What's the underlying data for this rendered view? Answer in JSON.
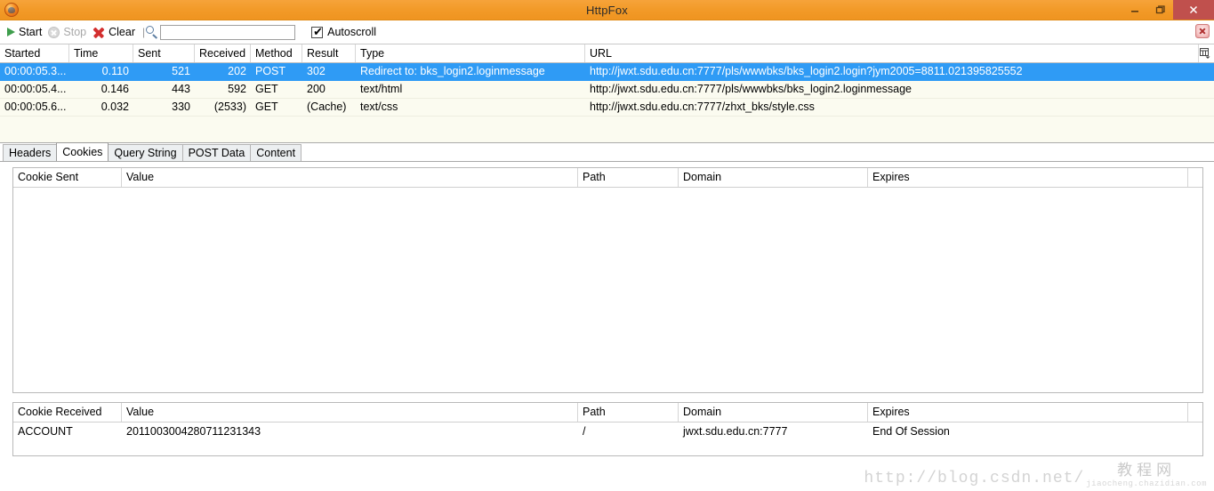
{
  "window": {
    "title": "HttpFox",
    "app_icon": "firefox-icon",
    "minimize_label": "–",
    "restore_label": "❐",
    "close_label": "×"
  },
  "toolbar": {
    "start_label": "Start",
    "stop_label": "Stop",
    "clear_label": "Clear",
    "separator": "|",
    "search_icon": "magnifier-icon",
    "search_value": "",
    "search_placeholder": "",
    "autoscroll_label": "Autoscroll",
    "autoscroll_checked": true,
    "autoscroll_tick": "✔",
    "close_icon": "close-panel-icon"
  },
  "request_grid": {
    "columns": [
      "Started",
      "Time",
      "Sent",
      "Received",
      "Method",
      "Result",
      "Type",
      "URL"
    ],
    "column_chooser_icon": "column-chooser-icon",
    "rows": [
      {
        "started": "00:00:05.3...",
        "time": "0.110",
        "sent": "521",
        "received": "202",
        "method": "POST",
        "result": "302",
        "type": "Redirect to: bks_login2.loginmessage",
        "url": "http://jwxt.sdu.edu.cn:7777/pls/wwwbks/bks_login2.login?jym2005=8811.021395825552",
        "selected": true
      },
      {
        "started": "00:00:05.4...",
        "time": "0.146",
        "sent": "443",
        "received": "592",
        "method": "GET",
        "result": "200",
        "type": "text/html",
        "url": "http://jwxt.sdu.edu.cn:7777/pls/wwwbks/bks_login2.loginmessage",
        "selected": false
      },
      {
        "started": "00:00:05.6...",
        "time": "0.032",
        "sent": "330",
        "received": "(2533)",
        "method": "GET",
        "result": "(Cache)",
        "type": "text/css",
        "url": "http://jwxt.sdu.edu.cn:7777/zhxt_bks/style.css",
        "selected": false
      }
    ]
  },
  "tabs": [
    {
      "label": "Headers",
      "active": false
    },
    {
      "label": "Cookies",
      "active": true
    },
    {
      "label": "Query String",
      "active": false
    },
    {
      "label": "POST Data",
      "active": false
    },
    {
      "label": "Content",
      "active": false
    }
  ],
  "cookies_sent": {
    "columns": [
      "Cookie Sent",
      "Value",
      "Path",
      "Domain",
      "Expires"
    ],
    "rows": []
  },
  "cookies_received": {
    "columns": [
      "Cookie Received",
      "Value",
      "Path",
      "Domain",
      "Expires"
    ],
    "rows": [
      {
        "name": "ACCOUNT",
        "value": "2011003004280711231343",
        "path": "/",
        "domain": "jwxt.sdu.edu.cn:7777",
        "expires": "End Of Session"
      }
    ]
  },
  "watermark": {
    "url": "http://blog.csdn.net/",
    "brand_cn": "教程网",
    "brand_sub": "jiaocheng.chazidian.com"
  },
  "colors": {
    "titlebar": "#f29a28",
    "selection": "#2f9bf5",
    "close_button": "#c0504d",
    "grid_background": "#fbfbf0"
  }
}
